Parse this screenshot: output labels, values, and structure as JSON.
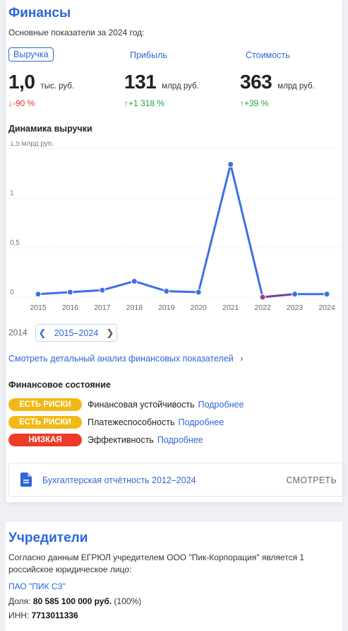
{
  "finances": {
    "title": "Финансы",
    "subtitle": "Основные показатели за 2024 год:",
    "metrics": [
      {
        "tab": "Выручка",
        "value": "1,0",
        "unit": "тыс. руб.",
        "delta": "↓-90 %",
        "direction": "down",
        "active": true
      },
      {
        "tab": "Прибыль",
        "value": "131",
        "unit": "млрд руб.",
        "delta": "↑+1 318 %",
        "direction": "up",
        "active": false
      },
      {
        "tab": "Стоимость",
        "value": "363",
        "unit": "млрд руб.",
        "delta": "↑+39 %",
        "direction": "up",
        "active": false
      }
    ],
    "chart_title": "Динамика выручки",
    "range": {
      "prev_year": "2014",
      "label": "2015–2024",
      "prev_icon": "chevron-left-icon",
      "next_icon": "chevron-right-icon"
    },
    "analysis_link": "Смотреть детальный анализ финансовых показателей",
    "state_title": "Финансовое состояние",
    "states": [
      {
        "badge": "ЕСТЬ РИСКИ",
        "level": "warn",
        "label": "Финансовая устойчивость",
        "more": "Подробнее"
      },
      {
        "badge": "ЕСТЬ РИСКИ",
        "level": "warn",
        "label": "Платежеспособность",
        "more": "Подробнее"
      },
      {
        "badge": "НИЗКАЯ",
        "level": "bad",
        "label": "Эффективность",
        "more": "Подробнее"
      }
    ],
    "report": {
      "title": "Бухгалтерская отчётность 2012–2024",
      "button": "СМОТРЕТЬ"
    }
  },
  "chart_data": {
    "type": "line",
    "ylabel": "1,5 млрд руб.",
    "ylim": [
      0,
      1.5
    ],
    "ytick_labels": [
      "0",
      "0,5",
      "1",
      "1,5 млрд руб."
    ],
    "yticks": [
      0,
      0.5,
      1,
      1.5
    ],
    "categories": [
      "2015",
      "2016",
      "2017",
      "2018",
      "2019",
      "2020",
      "2021",
      "2022",
      "2023",
      "2024"
    ],
    "values": [
      0.03,
      0.05,
      0.07,
      0.16,
      0.06,
      0.05,
      1.34,
      0.0,
      0.03,
      0.03
    ],
    "grid": true,
    "colors": {
      "line": "#3d6fe6",
      "point": "#3d6fe6",
      "low_point": "#9c3f7a",
      "low_segment": "#7c3aa0"
    }
  },
  "founders": {
    "title": "Учредители",
    "description": "Согласно данным ЕГРЮЛ учредителем ООО \"Пик-Корпорация\" является 1 российское юридическое лицо:",
    "company": "ПАО \"ПИК СЗ\"",
    "share_label": "Доля:",
    "share_value": "80 585 100 000 руб.",
    "share_percent": "(100%)",
    "inn_label": "ИНН:",
    "inn_value": "7713011336"
  }
}
